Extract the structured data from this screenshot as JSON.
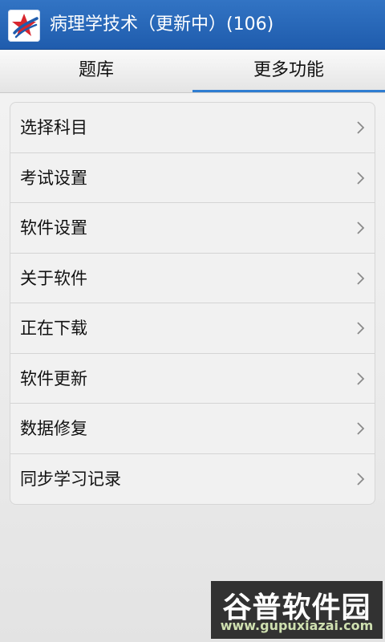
{
  "header": {
    "title": "病理学技术（更新中）(106)",
    "logo_icon": "star-logo-icon",
    "colors": {
      "bar": "#2466b8",
      "text": "#ffffff"
    }
  },
  "tabs": [
    {
      "label": "题库",
      "active": false
    },
    {
      "label": "更多功能",
      "active": true
    }
  ],
  "menu": {
    "items": [
      {
        "label": "选择科目"
      },
      {
        "label": "考试设置"
      },
      {
        "label": "软件设置"
      },
      {
        "label": "关于软件"
      },
      {
        "label": "正在下载"
      },
      {
        "label": "软件更新"
      },
      {
        "label": "数据修复"
      },
      {
        "label": "同步学习记录"
      }
    ],
    "chevron_icon": "chevron-right-icon"
  },
  "watermark": {
    "brand": "谷普软件园",
    "url": "www.gupuxiazai.com"
  }
}
